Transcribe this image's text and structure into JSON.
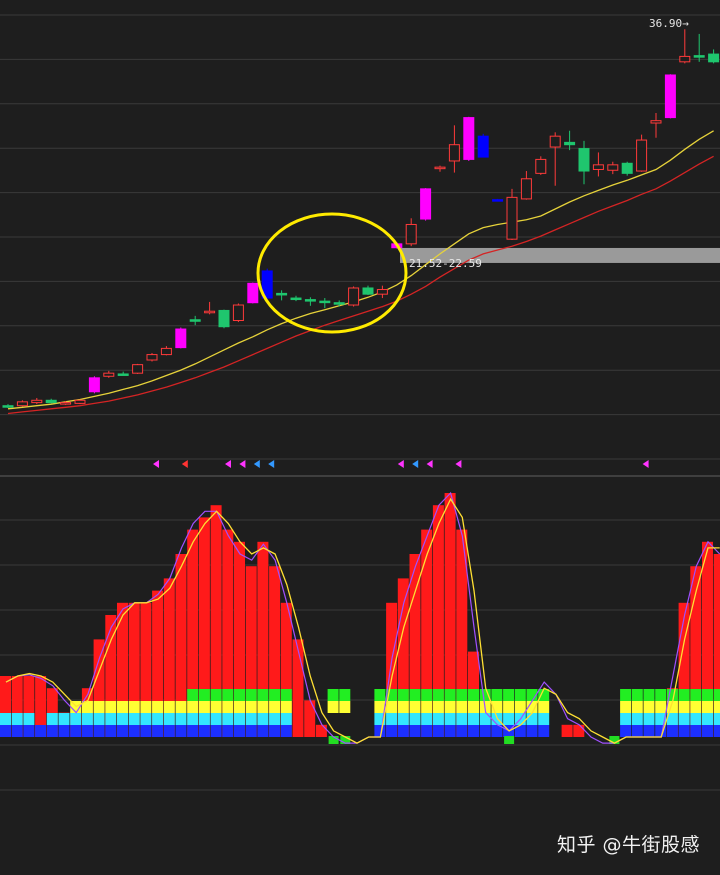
{
  "watermark": "知乎 @牛街股感",
  "colors": {
    "background": "#1e1e1e",
    "grid": "#3a3a3a",
    "up_candle": "#ff3a3a",
    "down_candle": "#1fc66e",
    "strong_up": "#ff00ff",
    "strong_down": "#0000ff",
    "ma_fast": "#e6d23a",
    "ma_slow": "#d42424",
    "highlight_circle": "#ffeb00",
    "zone_band": "#9a9a9a"
  },
  "chart_data": [
    {
      "type": "candlestick",
      "annotations": {
        "zone_label": "21.52-22.59",
        "price_label": "36.90→"
      },
      "candles": [
        {
          "o": 12.55,
          "h": 12.7,
          "l": 12.45,
          "c": 12.6,
          "t": "down"
        },
        {
          "o": 12.6,
          "h": 12.95,
          "l": 12.55,
          "c": 12.85,
          "t": "up"
        },
        {
          "o": 12.8,
          "h": 13.1,
          "l": 12.7,
          "c": 12.95,
          "t": "up"
        },
        {
          "o": 12.95,
          "h": 13.05,
          "l": 12.75,
          "c": 12.8,
          "t": "down"
        },
        {
          "o": 12.75,
          "h": 12.9,
          "l": 12.65,
          "c": 12.8,
          "t": "up"
        },
        {
          "o": 12.75,
          "h": 13.0,
          "l": 12.7,
          "c": 12.95,
          "t": "up"
        },
        {
          "o": 13.5,
          "h": 14.5,
          "l": 13.4,
          "c": 14.4,
          "t": "strong_up"
        },
        {
          "o": 14.5,
          "h": 14.85,
          "l": 14.4,
          "c": 14.7,
          "t": "up"
        },
        {
          "o": 14.6,
          "h": 14.8,
          "l": 14.55,
          "c": 14.65,
          "t": "down"
        },
        {
          "o": 14.7,
          "h": 15.3,
          "l": 14.65,
          "c": 15.25,
          "t": "up"
        },
        {
          "o": 15.55,
          "h": 16.0,
          "l": 15.45,
          "c": 15.9,
          "t": "up"
        },
        {
          "o": 15.9,
          "h": 16.45,
          "l": 15.85,
          "c": 16.3,
          "t": "up"
        },
        {
          "o": 16.35,
          "h": 17.65,
          "l": 16.3,
          "c": 17.55,
          "t": "strong_up"
        },
        {
          "o": 18.05,
          "h": 18.4,
          "l": 17.8,
          "c": 18.15,
          "t": "down"
        },
        {
          "o": 18.6,
          "h": 19.3,
          "l": 18.5,
          "c": 18.7,
          "t": "up"
        },
        {
          "o": 17.7,
          "h": 18.8,
          "l": 17.6,
          "c": 18.75,
          "t": "down"
        },
        {
          "o": 18.1,
          "h": 19.2,
          "l": 18.0,
          "c": 19.1,
          "t": "up"
        },
        {
          "o": 19.25,
          "h": 20.55,
          "l": 19.2,
          "c": 20.5,
          "t": "strong_up"
        },
        {
          "o": 21.3,
          "h": 21.45,
          "l": 19.6,
          "c": 19.55,
          "t": "strong_down"
        },
        {
          "o": 19.75,
          "h": 20.05,
          "l": 19.4,
          "c": 19.85,
          "t": "down"
        },
        {
          "o": 19.5,
          "h": 19.7,
          "l": 19.35,
          "c": 19.55,
          "t": "down"
        },
        {
          "o": 19.4,
          "h": 19.6,
          "l": 19.05,
          "c": 19.45,
          "t": "down"
        },
        {
          "o": 19.35,
          "h": 19.55,
          "l": 18.9,
          "c": 19.3,
          "t": "down"
        },
        {
          "o": 19.2,
          "h": 19.4,
          "l": 19.0,
          "c": 19.25,
          "t": "down"
        },
        {
          "o": 19.1,
          "h": 20.3,
          "l": 19.0,
          "c": 20.2,
          "t": "up"
        },
        {
          "o": 20.2,
          "h": 20.35,
          "l": 19.75,
          "c": 19.8,
          "t": "down"
        },
        {
          "o": 20.1,
          "h": 20.35,
          "l": 19.55,
          "c": 19.8,
          "t": "up"
        },
        {
          "o": 22.8,
          "h": 23.15,
          "l": 22.75,
          "c": 23.05,
          "t": "strong_up"
        },
        {
          "o": 23.05,
          "h": 24.7,
          "l": 22.9,
          "c": 24.3,
          "t": "up"
        },
        {
          "o": 24.65,
          "h": 26.65,
          "l": 24.55,
          "c": 26.6,
          "t": "strong_up"
        },
        {
          "o": 28.0,
          "h": 28.1,
          "l": 27.7,
          "c": 28.0,
          "t": "up"
        },
        {
          "o": 29.45,
          "h": 30.7,
          "l": 27.65,
          "c": 28.4,
          "t": "up"
        },
        {
          "o": 28.5,
          "h": 31.25,
          "l": 28.4,
          "c": 31.2,
          "t": "strong_up"
        },
        {
          "o": 30.0,
          "h": 30.15,
          "l": 28.65,
          "c": 28.65,
          "t": "strong_down"
        },
        {
          "o": 25.9,
          "h": 25.95,
          "l": 25.85,
          "c": 25.9,
          "t": "strong_down"
        },
        {
          "o": 23.35,
          "h": 26.6,
          "l": 23.3,
          "c": 26.05,
          "t": "up"
        },
        {
          "o": 25.95,
          "h": 27.75,
          "l": 25.9,
          "c": 27.25,
          "t": "up"
        },
        {
          "o": 27.6,
          "h": 28.7,
          "l": 27.5,
          "c": 28.5,
          "t": "up"
        },
        {
          "o": 29.3,
          "h": 30.25,
          "l": 26.8,
          "c": 30.0,
          "t": "up"
        },
        {
          "o": 29.6,
          "h": 30.35,
          "l": 29.1,
          "c": 29.45,
          "t": "down"
        },
        {
          "o": 29.2,
          "h": 29.7,
          "l": 26.9,
          "c": 27.75,
          "t": "down"
        },
        {
          "o": 28.15,
          "h": 28.95,
          "l": 27.4,
          "c": 27.85,
          "t": "up"
        },
        {
          "o": 27.8,
          "h": 28.35,
          "l": 27.55,
          "c": 28.15,
          "t": "up"
        },
        {
          "o": 28.25,
          "h": 28.35,
          "l": 27.45,
          "c": 27.6,
          "t": "down"
        },
        {
          "o": 27.75,
          "h": 30.1,
          "l": 27.7,
          "c": 29.75,
          "t": "up"
        },
        {
          "o": 30.85,
          "h": 31.5,
          "l": 29.9,
          "c": 31.0,
          "t": "up"
        },
        {
          "o": 31.2,
          "h": 34.0,
          "l": 31.15,
          "c": 33.95,
          "t": "strong_up"
        },
        {
          "o": 34.8,
          "h": 36.9,
          "l": 34.7,
          "c": 35.15,
          "t": "up"
        },
        {
          "o": 35.1,
          "h": 36.6,
          "l": 34.8,
          "c": 35.2,
          "t": "down"
        },
        {
          "o": 35.3,
          "h": 35.6,
          "l": 34.7,
          "c": 34.8,
          "t": "down"
        }
      ],
      "ma_fast": [
        12.4,
        12.5,
        12.6,
        12.7,
        12.85,
        13.0,
        13.2,
        13.4,
        13.65,
        13.9,
        14.2,
        14.55,
        14.9,
        15.3,
        15.75,
        16.2,
        16.65,
        17.05,
        17.5,
        17.9,
        18.25,
        18.55,
        18.8,
        19.05,
        19.3,
        19.6,
        19.95,
        20.4,
        21.0,
        21.7,
        22.4,
        23.05,
        23.7,
        24.1,
        24.3,
        24.45,
        24.6,
        24.85,
        25.3,
        25.75,
        26.15,
        26.5,
        26.85,
        27.15,
        27.5,
        27.85,
        28.45,
        29.15,
        29.8,
        30.35
      ],
      "ma_slow": [
        12.1,
        12.2,
        12.3,
        12.4,
        12.5,
        12.6,
        12.75,
        12.9,
        13.1,
        13.3,
        13.55,
        13.8,
        14.1,
        14.4,
        14.75,
        15.1,
        15.5,
        15.9,
        16.3,
        16.7,
        17.1,
        17.45,
        17.8,
        18.1,
        18.4,
        18.7,
        19.0,
        19.35,
        19.8,
        20.3,
        20.9,
        21.45,
        22.0,
        22.4,
        22.65,
        22.9,
        23.2,
        23.55,
        23.95,
        24.35,
        24.75,
        25.15,
        25.5,
        25.85,
        26.25,
        26.6,
        27.1,
        27.65,
        28.2,
        28.7
      ],
      "signals": [
        {
          "i": 10,
          "color": "#ff33ff"
        },
        {
          "i": 12,
          "color": "#ff3333"
        },
        {
          "i": 15,
          "color": "#ff33ff"
        },
        {
          "i": 16,
          "color": "#ff33ff"
        },
        {
          "i": 17,
          "color": "#3399ff"
        },
        {
          "i": 18,
          "color": "#3399ff"
        },
        {
          "i": 27,
          "color": "#ff33ff"
        },
        {
          "i": 28,
          "color": "#3399ff"
        },
        {
          "i": 29,
          "color": "#ff33ff"
        },
        {
          "i": 31,
          "color": "#ff33ff"
        },
        {
          "i": 44,
          "color": "#ff33ff"
        }
      ]
    },
    {
      "type": "bar",
      "values": [
        5,
        5,
        5,
        5,
        4,
        2,
        2,
        4,
        8,
        10,
        11,
        11,
        11,
        12,
        13,
        15,
        17,
        18,
        19,
        17,
        16,
        14,
        16,
        14,
        11,
        8,
        3,
        1,
        0,
        0,
        0,
        0,
        0,
        11,
        13,
        15,
        17,
        19,
        20,
        17,
        7,
        0,
        2,
        0,
        0,
        0,
        0,
        0,
        1,
        1,
        0,
        0,
        0,
        0,
        0,
        0,
        0,
        4,
        11,
        14,
        16,
        15
      ],
      "colors": [
        "red",
        "red",
        "red",
        "red",
        "red",
        "red",
        "red",
        "red",
        "red",
        "red",
        "red",
        "red",
        "red",
        "red",
        "red",
        "red",
        "red",
        "red",
        "red",
        "red",
        "red",
        "red",
        "red",
        "red",
        "red",
        "red",
        "red",
        "red",
        "none",
        "none",
        "none",
        "none",
        "none",
        "red",
        "red",
        "red",
        "red",
        "red",
        "red",
        "red",
        "red",
        "red",
        "red",
        "green",
        "green",
        "green",
        "none",
        "none",
        "red",
        "red",
        "none",
        "none",
        "none",
        "none",
        "red",
        "red",
        "red",
        "red",
        "red",
        "red",
        "red",
        "red"
      ],
      "layers": {
        "green_band": [
          0,
          0,
          0,
          0,
          0,
          0,
          0,
          0,
          0,
          0,
          0,
          0,
          0,
          0,
          0,
          0,
          1,
          1,
          1,
          1,
          1,
          1,
          1,
          1,
          1,
          0,
          0,
          0,
          1,
          1,
          0,
          0,
          1,
          1,
          1,
          1,
          1,
          1,
          1,
          1,
          1,
          1,
          1,
          1,
          1,
          1,
          1,
          0,
          0,
          0,
          0,
          0,
          0,
          1,
          1,
          1,
          1,
          1,
          1,
          1,
          1,
          1
        ],
        "yellow_band": [
          0,
          0,
          0,
          0,
          0,
          0,
          1,
          1,
          1,
          1,
          1,
          1,
          1,
          1,
          1,
          1,
          1,
          1,
          1,
          1,
          1,
          1,
          1,
          1,
          1,
          0,
          0,
          0,
          1,
          1,
          0,
          0,
          1,
          1,
          1,
          1,
          1,
          1,
          1,
          1,
          1,
          1,
          1,
          1,
          1,
          1,
          1,
          0,
          0,
          0,
          0,
          0,
          0,
          1,
          1,
          1,
          1,
          1,
          1,
          1,
          1,
          1
        ],
        "cyan_band": [
          1,
          1,
          1,
          0,
          1,
          1,
          1,
          1,
          1,
          1,
          1,
          1,
          1,
          1,
          1,
          1,
          1,
          1,
          1,
          1,
          1,
          1,
          1,
          1,
          1,
          0,
          0,
          0,
          0,
          0,
          0,
          0,
          1,
          1,
          1,
          1,
          1,
          1,
          1,
          1,
          1,
          1,
          1,
          1,
          1,
          1,
          1,
          0,
          0,
          0,
          0,
          0,
          0,
          1,
          1,
          1,
          1,
          1,
          1,
          1,
          1,
          1
        ],
        "blue_band": [
          1,
          1,
          1,
          1,
          1,
          1,
          1,
          1,
          1,
          1,
          1,
          1,
          1,
          1,
          1,
          1,
          1,
          1,
          1,
          1,
          1,
          1,
          1,
          1,
          1,
          0,
          0,
          0,
          0,
          0,
          0,
          0,
          1,
          1,
          1,
          1,
          1,
          1,
          1,
          1,
          1,
          1,
          1,
          1,
          1,
          1,
          1,
          0,
          0,
          0,
          0,
          0,
          0,
          1,
          1,
          1,
          1,
          1,
          1,
          1,
          1,
          1
        ]
      },
      "line_yellow": [
        4.5,
        5,
        5.2,
        5,
        4.5,
        3.5,
        2.5,
        3,
        5.5,
        8,
        10,
        11,
        11,
        11.3,
        12.2,
        14,
        16,
        17.5,
        18.5,
        17.5,
        16,
        15,
        15.5,
        15,
        12.5,
        9,
        5,
        2,
        0.5,
        0,
        -0.5,
        0,
        0,
        5,
        9,
        12,
        15,
        17.5,
        19.5,
        18,
        12,
        4,
        1.5,
        0.5,
        1,
        2,
        4,
        3.5,
        2,
        1.5,
        0.5,
        0,
        -0.5,
        0,
        0,
        0,
        0,
        3,
        8,
        12,
        15.5,
        15.5
      ],
      "line_purple": [
        4.5,
        5,
        5.1,
        4.8,
        4.2,
        3,
        2,
        3.5,
        6.5,
        9,
        10.5,
        11,
        11,
        11.7,
        13,
        15.5,
        17.5,
        18.5,
        18.5,
        16.5,
        15,
        14.5,
        15.8,
        14.5,
        11,
        7,
        3,
        1,
        0,
        -0.5,
        -0.5,
        0,
        0,
        6.5,
        11,
        14,
        16.5,
        19,
        20,
        16.5,
        9,
        2,
        1,
        0.5,
        1.5,
        3,
        4.5,
        3.5,
        1.5,
        1,
        0,
        -0.5,
        -0.5,
        0,
        0,
        0,
        0,
        5,
        10,
        14,
        16,
        15
      ]
    }
  ]
}
